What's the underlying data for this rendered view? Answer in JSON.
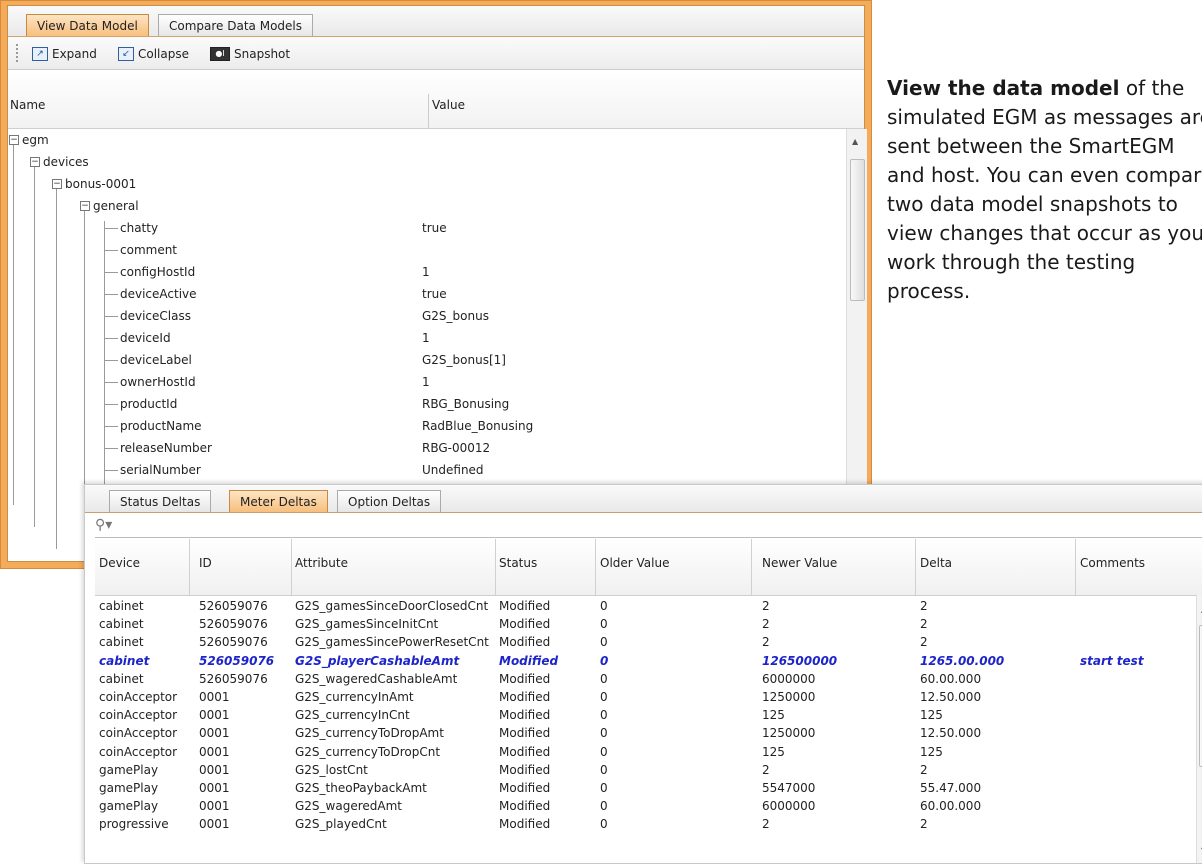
{
  "window1": {
    "tabs": [
      {
        "label": "View Data Model",
        "active": true
      },
      {
        "label": "Compare Data Models",
        "active": false
      }
    ],
    "toolbar": {
      "expand_label": "Expand",
      "collapse_label": "Collapse",
      "snapshot_label": "Snapshot"
    },
    "columns": {
      "name": "Name",
      "value": "Value"
    },
    "tree": {
      "root": "egm",
      "devices": "devices",
      "device": "bonus-0001",
      "group": "general",
      "properties": [
        {
          "name": "chatty",
          "value": "true"
        },
        {
          "name": "comment",
          "value": ""
        },
        {
          "name": "configHostId",
          "value": "1"
        },
        {
          "name": "deviceActive",
          "value": "true"
        },
        {
          "name": "deviceClass",
          "value": "G2S_bonus"
        },
        {
          "name": "deviceId",
          "value": "1"
        },
        {
          "name": "deviceLabel",
          "value": "G2S_bonus[1]"
        },
        {
          "name": "ownerHostId",
          "value": "1"
        },
        {
          "name": "productId",
          "value": "RBG_Bonusing"
        },
        {
          "name": "productName",
          "value": "RadBlue_Bonusing"
        },
        {
          "name": "releaseNumber",
          "value": "RBG-00012"
        },
        {
          "name": "serialNumber",
          "value": "Undefined"
        }
      ]
    }
  },
  "window2": {
    "tabs": [
      {
        "label": "Status Deltas",
        "active": false
      },
      {
        "label": "Meter Deltas",
        "active": true
      },
      {
        "label": "Option Deltas",
        "active": false
      }
    ],
    "columns": [
      "Device",
      "ID",
      "Attribute",
      "Status",
      "Older Value",
      "Newer Value",
      "Delta",
      "Comments"
    ],
    "rows": [
      {
        "device": "cabinet",
        "id": "526059076",
        "attribute": "G2S_gamesSinceDoorClosedCnt",
        "status": "Modified",
        "older": "0",
        "newer": "2",
        "delta": "2",
        "comments": "",
        "highlight": false
      },
      {
        "device": "cabinet",
        "id": "526059076",
        "attribute": "G2S_gamesSinceInitCnt",
        "status": "Modified",
        "older": "0",
        "newer": "2",
        "delta": "2",
        "comments": "",
        "highlight": false
      },
      {
        "device": "cabinet",
        "id": "526059076",
        "attribute": "G2S_gamesSincePowerResetCnt",
        "status": "Modified",
        "older": "0",
        "newer": "2",
        "delta": "2",
        "comments": "",
        "highlight": false
      },
      {
        "device": "cabinet",
        "id": "526059076",
        "attribute": "G2S_playerCashableAmt",
        "status": "Modified",
        "older": "0",
        "newer": "126500000",
        "delta": "1265.00.000",
        "comments": "start test",
        "highlight": true
      },
      {
        "device": "cabinet",
        "id": "526059076",
        "attribute": "G2S_wageredCashableAmt",
        "status": "Modified",
        "older": "0",
        "newer": "6000000",
        "delta": "60.00.000",
        "comments": "",
        "highlight": false
      },
      {
        "device": "coinAcceptor",
        "id": "0001",
        "attribute": "G2S_currencyInAmt",
        "status": "Modified",
        "older": "0",
        "newer": "1250000",
        "delta": "12.50.000",
        "comments": "",
        "highlight": false
      },
      {
        "device": "coinAcceptor",
        "id": "0001",
        "attribute": "G2S_currencyInCnt",
        "status": "Modified",
        "older": "0",
        "newer": "125",
        "delta": "125",
        "comments": "",
        "highlight": false
      },
      {
        "device": "coinAcceptor",
        "id": "0001",
        "attribute": "G2S_currencyToDropAmt",
        "status": "Modified",
        "older": "0",
        "newer": "1250000",
        "delta": "12.50.000",
        "comments": "",
        "highlight": false
      },
      {
        "device": "coinAcceptor",
        "id": "0001",
        "attribute": "G2S_currencyToDropCnt",
        "status": "Modified",
        "older": "0",
        "newer": "125",
        "delta": "125",
        "comments": "",
        "highlight": false
      },
      {
        "device": "gamePlay",
        "id": "0001",
        "attribute": "G2S_lostCnt",
        "status": "Modified",
        "older": "0",
        "newer": "2",
        "delta": "2",
        "comments": "",
        "highlight": false
      },
      {
        "device": "gamePlay",
        "id": "0001",
        "attribute": "G2S_theoPaybackAmt",
        "status": "Modified",
        "older": "0",
        "newer": "5547000",
        "delta": "55.47.000",
        "comments": "",
        "highlight": false
      },
      {
        "device": "gamePlay",
        "id": "0001",
        "attribute": "G2S_wageredAmt",
        "status": "Modified",
        "older": "0",
        "newer": "6000000",
        "delta": "60.00.000",
        "comments": "",
        "highlight": false
      },
      {
        "device": "progressive",
        "id": "0001",
        "attribute": "G2S_playedCnt",
        "status": "Modified",
        "older": "0",
        "newer": "2",
        "delta": "2",
        "comments": "",
        "highlight": false
      }
    ]
  },
  "description": {
    "bold": "View the data model",
    "rest": " of the simulated EGM as messages are sent between the SmartEGM and host. You can even compare two data model snapshots to view changes that occur as you work through the testing process."
  },
  "colors": {
    "accent": "#f4ac5a",
    "highlight_text": "#1e25c8"
  },
  "icons": [
    "expand-icon",
    "collapse-icon",
    "snapshot-icon",
    "search-icon"
  ]
}
